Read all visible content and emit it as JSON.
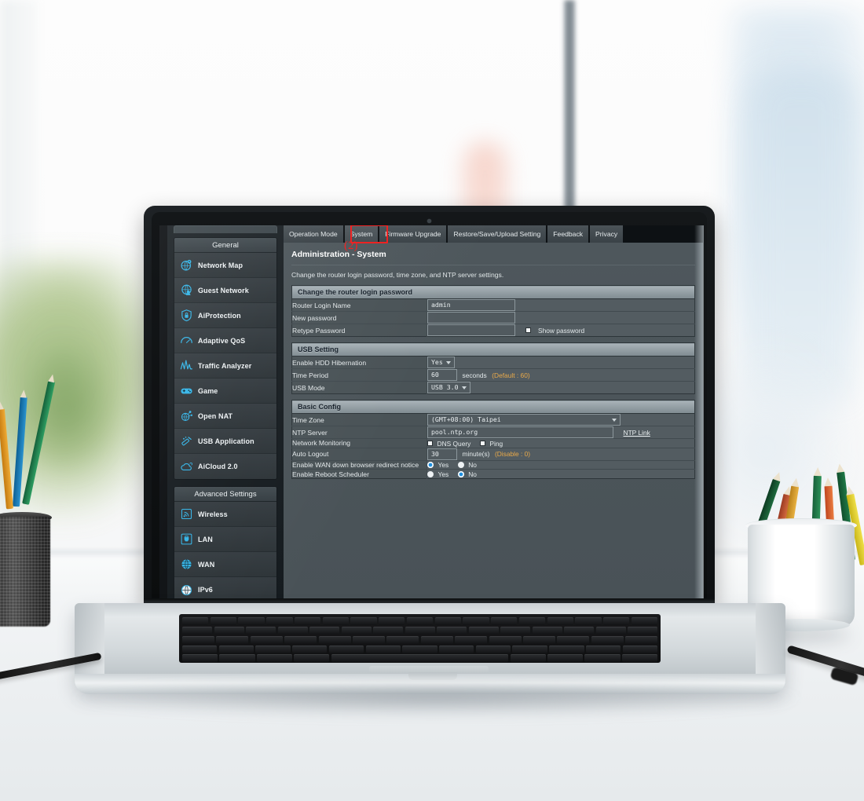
{
  "scene": {
    "description": "Laptop on a white desk showing a router administration web UI",
    "objects": [
      "mesh-pencil-cup",
      "white-pencil-cup",
      "pen",
      "laptop"
    ]
  },
  "sidebar": {
    "groups": [
      {
        "header": "General",
        "items": [
          {
            "label": "Network Map",
            "icon": "network-map-icon"
          },
          {
            "label": "Guest Network",
            "icon": "guest-network-icon"
          },
          {
            "label": "AiProtection",
            "icon": "shield-lock-icon"
          },
          {
            "label": "Adaptive QoS",
            "icon": "gauge-icon"
          },
          {
            "label": "Traffic Analyzer",
            "icon": "traffic-chart-icon"
          },
          {
            "label": "Game",
            "icon": "gamepad-icon"
          },
          {
            "label": "Open NAT",
            "icon": "open-nat-icon"
          },
          {
            "label": "USB Application",
            "icon": "usb-application-icon"
          },
          {
            "label": "AiCloud 2.0",
            "icon": "cloud-icon"
          }
        ]
      },
      {
        "header": "Advanced Settings",
        "items": [
          {
            "label": "Wireless",
            "icon": "wireless-icon"
          },
          {
            "label": "LAN",
            "icon": "lan-icon"
          },
          {
            "label": "WAN",
            "icon": "wan-globe-icon"
          },
          {
            "label": "IPv6",
            "icon": "ipv6-globe-icon"
          }
        ]
      }
    ]
  },
  "tabs": {
    "items": [
      {
        "label": "Operation Mode",
        "active": false
      },
      {
        "label": "System",
        "active": true
      },
      {
        "label": "Firmware Upgrade",
        "active": false
      },
      {
        "label": "Restore/Save/Upload Setting",
        "active": false
      },
      {
        "label": "Feedback",
        "active": false
      },
      {
        "label": "Privacy",
        "active": false
      }
    ],
    "highlight_color": "#ee1d1d",
    "step_badge": "(2)"
  },
  "page": {
    "title": "Administration - System",
    "description": "Change the router login password, time zone, and NTP server settings."
  },
  "sections": {
    "password": {
      "header": "Change the router login password",
      "rows": {
        "login_name_label": "Router Login Name",
        "login_name_value": "admin",
        "new_password_label": "New password",
        "new_password_value": "",
        "retype_password_label": "Retype Password",
        "retype_password_value": "",
        "show_password_label": "Show password"
      }
    },
    "usb": {
      "header": "USB Setting",
      "rows": {
        "hdd_hibernation_label": "Enable HDD Hibernation",
        "hdd_hibernation_value": "Yes",
        "time_period_label": "Time Period",
        "time_period_value": "60",
        "time_period_unit": "seconds",
        "time_period_hint": "(Default : 60)",
        "usb_mode_label": "USB Mode",
        "usb_mode_value": "USB 3.0"
      }
    },
    "basic": {
      "header": "Basic Config",
      "rows": {
        "time_zone_label": "Time Zone",
        "time_zone_value": "(GMT+08:00) Taipei",
        "ntp_server_label": "NTP Server",
        "ntp_server_value": "pool.ntp.org",
        "ntp_link_label": "NTP Link",
        "network_monitoring_label": "Network Monitoring",
        "dns_query_label": "DNS Query",
        "ping_label": "Ping",
        "auto_logout_label": "Auto Logout",
        "auto_logout_value": "30",
        "auto_logout_unit": "minute(s)",
        "auto_logout_hint": "(Disable : 0)",
        "wan_redirect_label": "Enable WAN down browser redirect notice",
        "wan_redirect_yes": "Yes",
        "wan_redirect_no": "No",
        "wan_redirect_selected": "Yes",
        "reboot_scheduler_label": "Enable Reboot Scheduler",
        "reboot_scheduler_yes": "Yes",
        "reboot_scheduler_no": "No",
        "reboot_scheduler_selected": "No"
      }
    }
  },
  "colors": {
    "accent_blue": "#1e8fe0",
    "icon_cyan": "#34b5e8",
    "highlight_red": "#ee1d1d",
    "hint_amber": "#e8a94a",
    "panel_bg": "#4e575c",
    "sidebar_bg": "#2b3135"
  }
}
